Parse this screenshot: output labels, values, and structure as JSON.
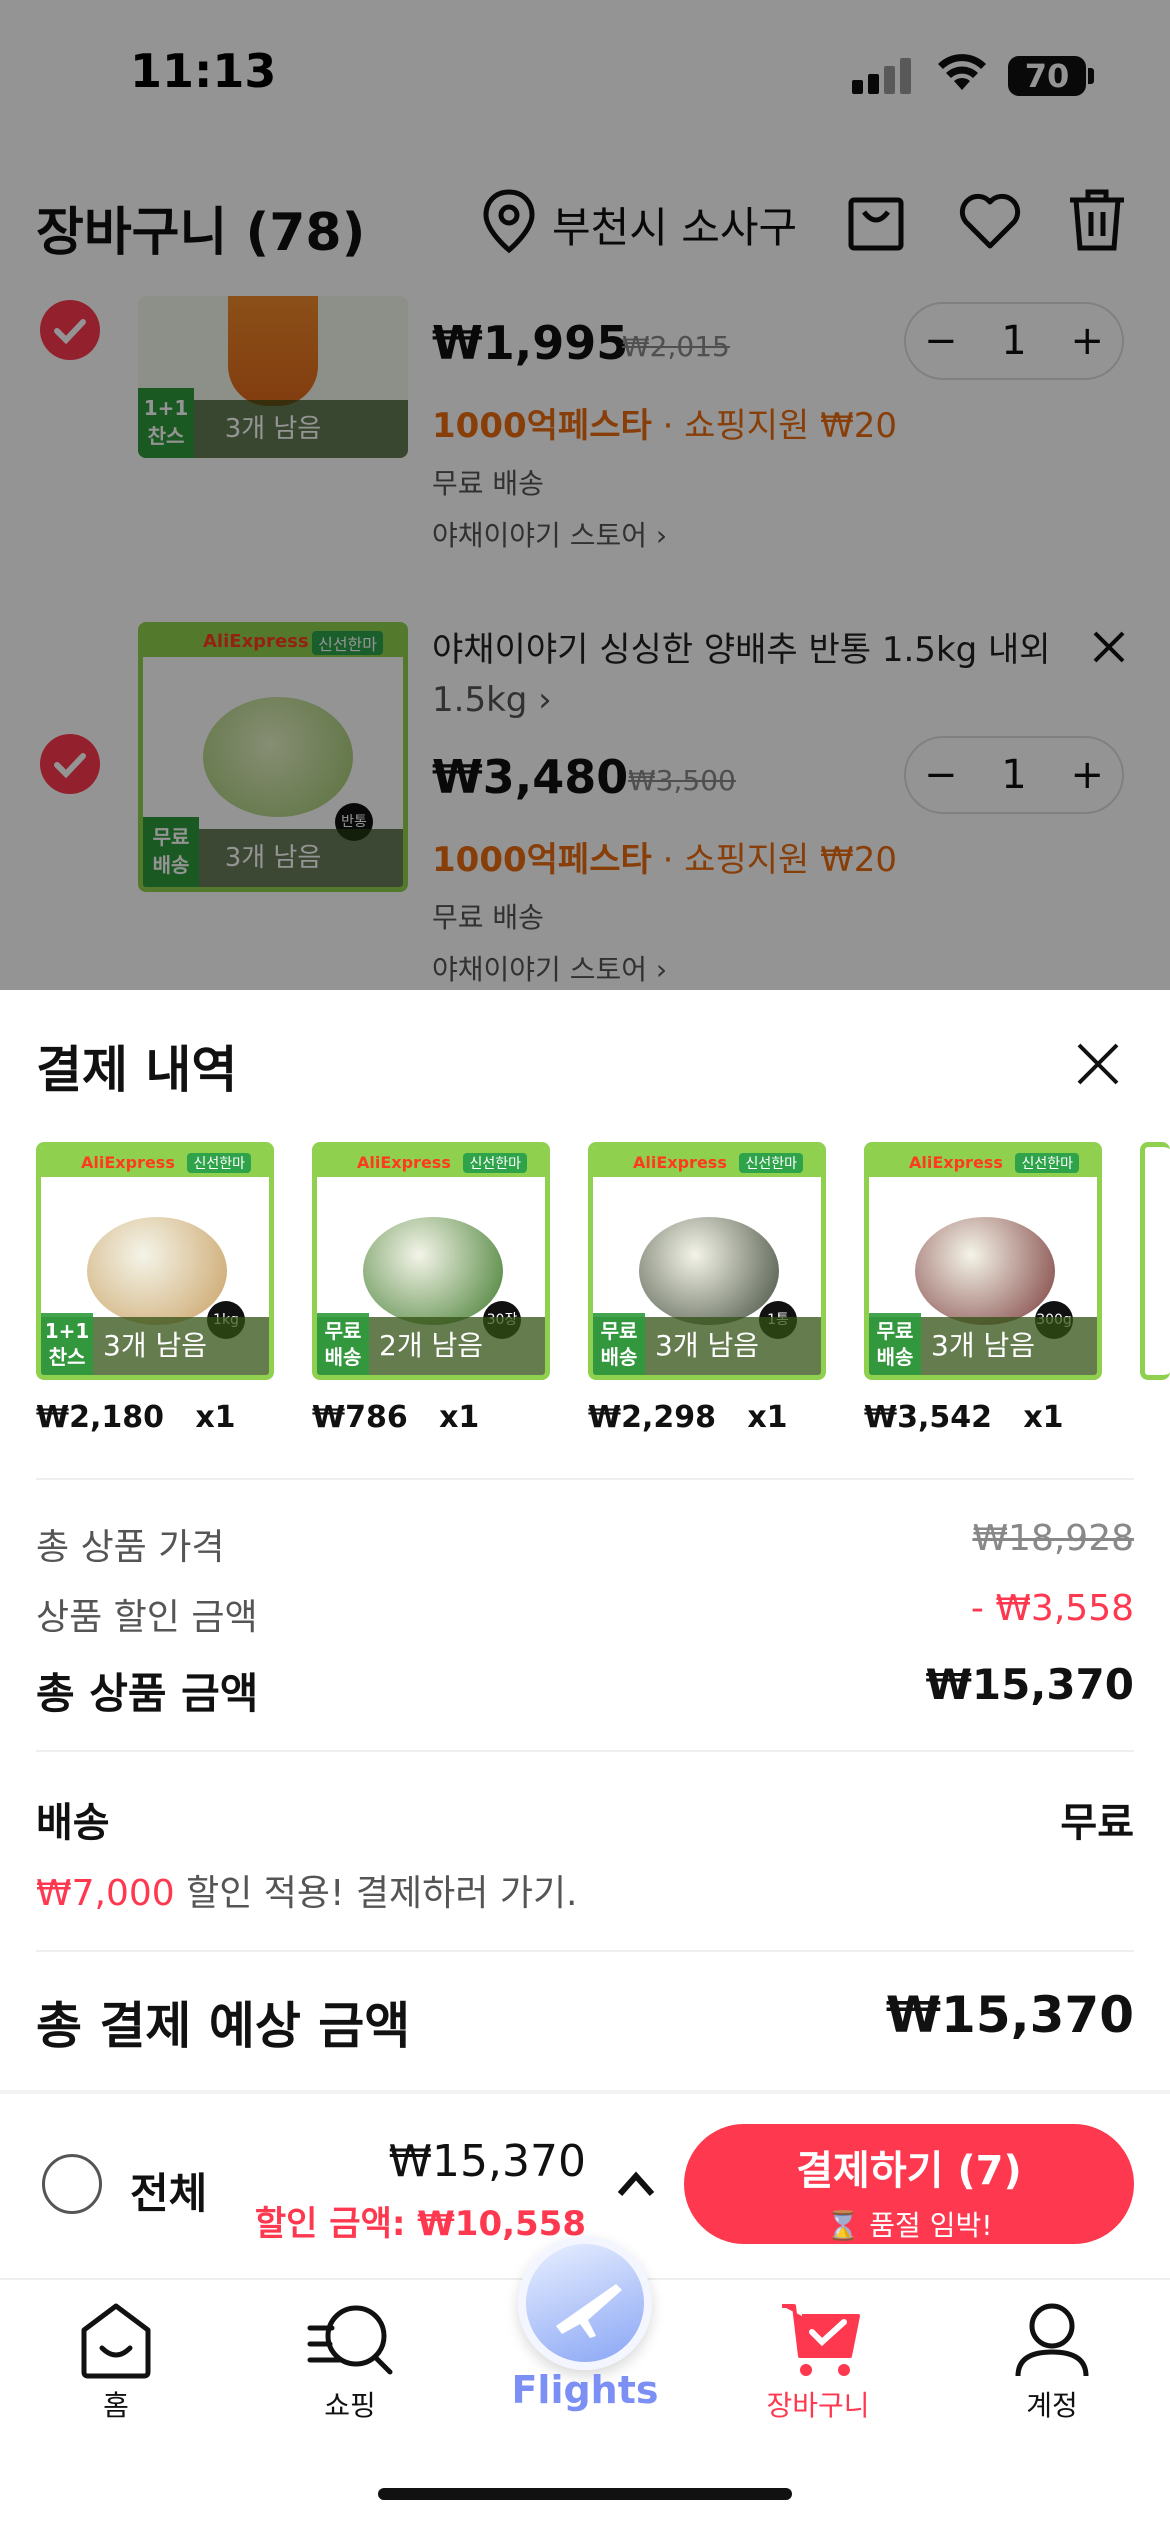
{
  "status_bar": {
    "time": "11:13",
    "battery": "70"
  },
  "header": {
    "title": "장바구니 (78)",
    "location": "부천시 소사구"
  },
  "cart_items": [
    {
      "price": "₩1,995",
      "old_price": "₩2,015",
      "promo_label": "1000억페스타",
      "promo_sub": "· 쇼핑지원 ₩20",
      "shipping": "무료 배송",
      "store": "야채이야기 스토어 ›",
      "qty": "1",
      "stock": "3개 남음",
      "badge": "1+1 찬스"
    },
    {
      "title": "야채이야기 싱싱한 양배추 반통 1.5kg 내외",
      "option": "1.5kg ›",
      "price": "₩3,480",
      "old_price": "₩3,500",
      "promo_label": "1000억페스타",
      "promo_sub": "· 쇼핑지원 ₩20",
      "shipping": "무료 배송",
      "store": "야채이야기 스토어 ›",
      "qty": "1",
      "stock": "3개 남음",
      "badge": "무료 배송",
      "thumb_logo": "AliExpress",
      "thumb_tag": "신선한마",
      "thumb_unit": "반통"
    }
  ],
  "sheet": {
    "title": "결제 내역",
    "items": [
      {
        "price": "₩2,180",
        "qty": "x1",
        "stock": "3개 남음",
        "badge": "1+1 찬스",
        "unit": "1kg",
        "color": "#c9a063"
      },
      {
        "price": "₩786",
        "qty": "x1",
        "stock": "2개 남음",
        "badge": "무료 배송",
        "unit": "30장",
        "color": "#3f7a2c"
      },
      {
        "price": "₩2,298",
        "qty": "x1",
        "stock": "3개 남음",
        "badge": "무료 배송",
        "unit": "1통",
        "color": "#3f4a3a"
      },
      {
        "price": "₩3,542",
        "qty": "x1",
        "stock": "3개 남음",
        "badge": "무료 배송",
        "unit": "300g",
        "color": "#7a3a3a"
      }
    ],
    "mini_logo": "AliExpress",
    "mini_tag": "신선한마",
    "total_price_label": "총 상품 가격",
    "total_price_value": "₩18,928",
    "discount_label": "상품 할인 금액",
    "discount_value": "- ₩3,558",
    "subtotal_label": "총 상품 금액",
    "subtotal_value": "₩15,370",
    "shipping_label": "배송",
    "shipping_value": "무료",
    "shipping_note_amount": "₩7,000",
    "shipping_note_text": " 할인 적용! 결제하러 가기.",
    "grand_label": "총 결제 예상 금액",
    "grand_value": "₩15,370"
  },
  "bottom_bar": {
    "select_all": "전체",
    "total": "₩15,370",
    "discount": "할인 금액: ₩10,558",
    "checkout": "결제하기 (7)",
    "checkout_sub": "⌛ 품절 임박!"
  },
  "tabs": [
    {
      "label": "홈"
    },
    {
      "label": "쇼핑"
    },
    {
      "label": "Flights"
    },
    {
      "label": "장바구니"
    },
    {
      "label": "계정"
    }
  ],
  "colors": {
    "accent": "#fd384f",
    "promo": "#e96c10",
    "fresh_green": "#8fd14f"
  }
}
